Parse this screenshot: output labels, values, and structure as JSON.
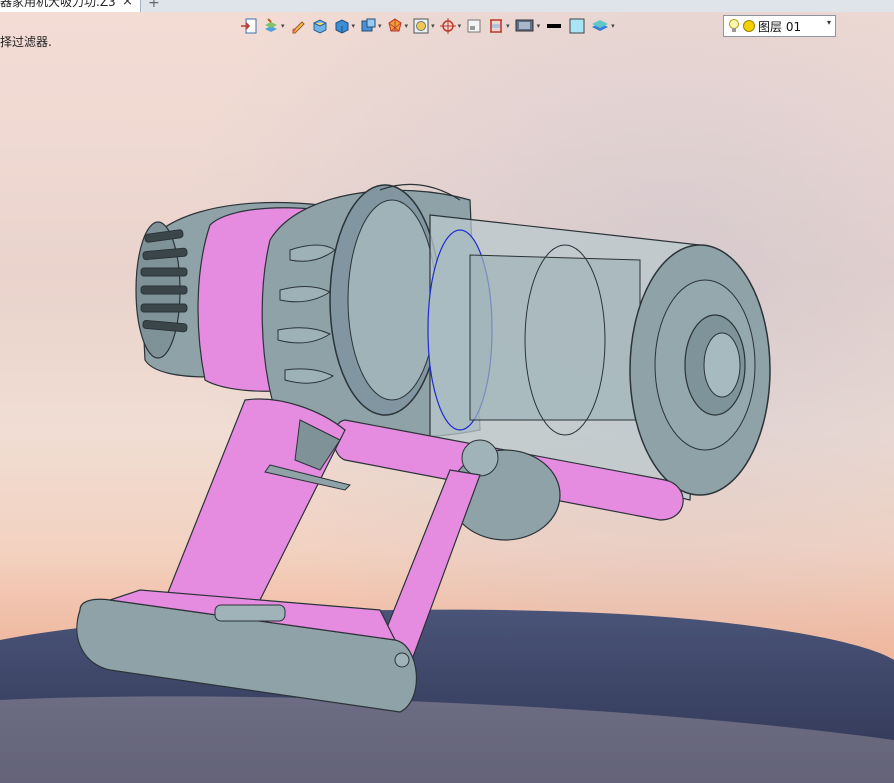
{
  "tab": {
    "title": "器家用机大吸力功.Z3",
    "close": "×",
    "add": "+"
  },
  "status": {
    "prompt": "择过滤器."
  },
  "layer": {
    "label": "图层 01",
    "dropdown": "▾"
  },
  "colors": {
    "viewport_top": "#f2dcd4",
    "viewport_bottom": "#e8a48f",
    "floor": "#3d4566",
    "part_gray": "#8fa2a8",
    "part_pink": "#e58be0",
    "transparent_bin": "#b9c8cc"
  },
  "toolbar": {
    "icons": [
      "import-icon",
      "paint-layers-icon",
      "pencil-icon",
      "box-face-icon",
      "cube-icon",
      "view-cube-icon",
      "polyhedron-icon",
      "fit-view-icon",
      "target-icon",
      "page-icon",
      "section-icon",
      "display-mode-icon",
      "line-color-icon",
      "face-color-icon",
      "layer-stack-icon"
    ]
  }
}
